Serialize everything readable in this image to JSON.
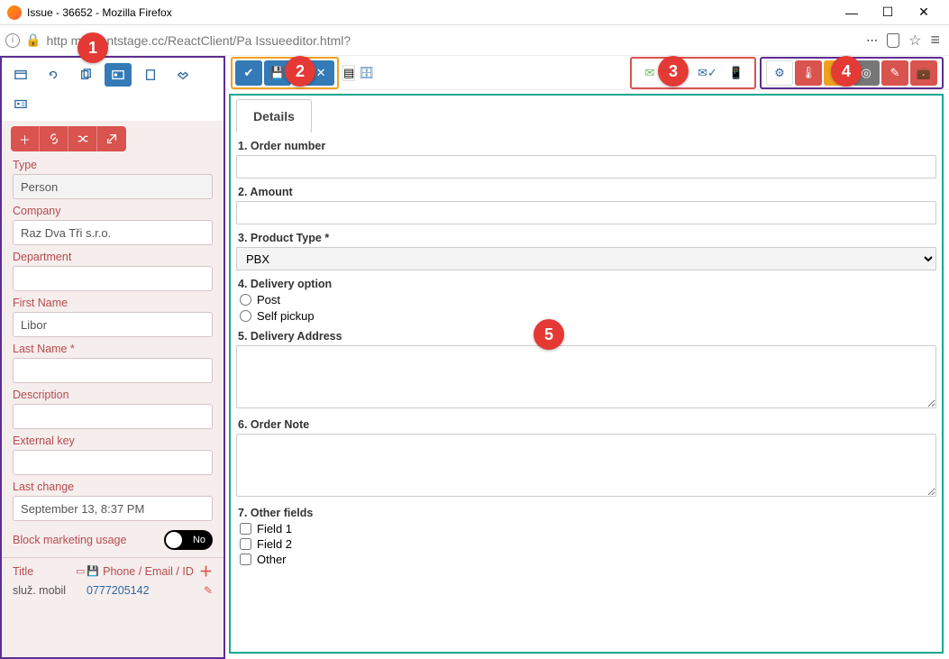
{
  "window": {
    "title": "Issue - 36652 - Mozilla Firefox"
  },
  "url": "http      mo.frontstage.cc/ReactClient/Pa         Issueeditor.html?",
  "callouts": {
    "c1": "1",
    "c2": "2",
    "c3": "3",
    "c4": "4",
    "c5": "5"
  },
  "sidebar": {
    "fields": {
      "type_label": "Type",
      "type_value": "Person",
      "company_label": "Company",
      "company_value": "Raz Dva Tři s.r.o.",
      "department_label": "Department",
      "department_value": "",
      "firstname_label": "First Name",
      "firstname_value": "Libor",
      "lastname_label": "Last Name *",
      "lastname_value": "",
      "description_label": "Description",
      "description_value": "",
      "externalkey_label": "External key",
      "externalkey_value": "",
      "lastchange_label": "Last change",
      "lastchange_value": "September 13, 8:37 PM",
      "marketing_label": "Block marketing usage",
      "marketing_value": "No"
    },
    "contact": {
      "title_col": "Title",
      "phone_col": "Phone / Email / ID",
      "row_title": "služ. mobil",
      "row_phone": "0777205142"
    }
  },
  "details": {
    "tab": "Details",
    "order_number_label": "1. Order number",
    "order_number_value": "",
    "amount_label": "2. Amount",
    "amount_value": "",
    "product_type_label": "3. Product Type *",
    "product_type_value": "PBX",
    "delivery_option_label": "4. Delivery option",
    "delivery_post": "Post",
    "delivery_self": "Self pickup",
    "delivery_address_label": "5. Delivery Address",
    "delivery_address_value": "",
    "order_note_label": "6. Order Note",
    "order_note_value": "",
    "other_fields_label": "7. Other fields",
    "field1": "Field 1",
    "field2": "Field 2",
    "other": "Other"
  }
}
